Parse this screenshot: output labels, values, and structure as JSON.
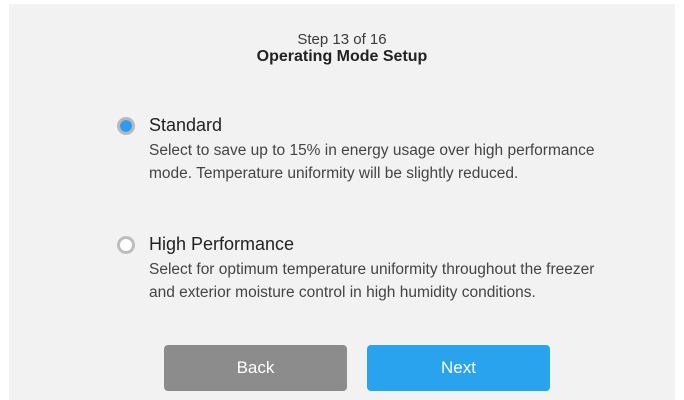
{
  "header": {
    "step": "Step 13 of 16",
    "title": "Operating Mode Setup"
  },
  "options": [
    {
      "label": "Standard",
      "description": "Select to save up to 15% in energy usage over high performance mode. Temperature uniformity will be slightly reduced.",
      "selected": true
    },
    {
      "label": "High Performance",
      "description": "Select for optimum temperature uniformity throughout the freezer and exterior moisture control in high humidity conditions.",
      "selected": false
    }
  ],
  "buttons": {
    "back": "Back",
    "next": "Next"
  },
  "colors": {
    "accent": "#2aa3ef",
    "back_button": "#8c8c8c",
    "background": "#f2f2f2"
  }
}
